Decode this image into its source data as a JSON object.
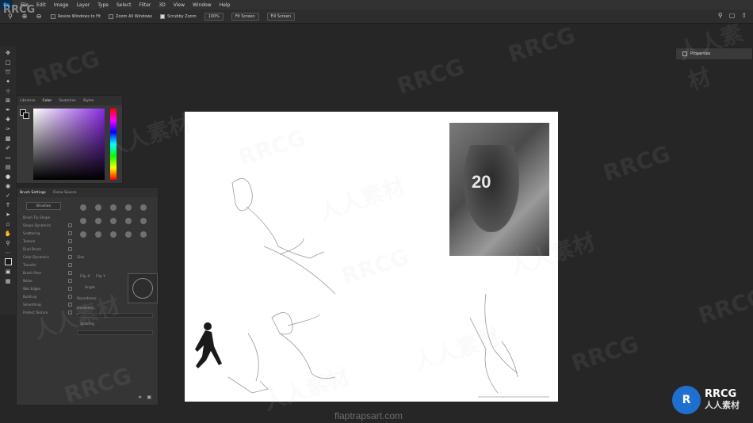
{
  "menu": {
    "logo": "Ps",
    "items": [
      "File",
      "Edit",
      "Image",
      "Layer",
      "Type",
      "Select",
      "Filter",
      "3D",
      "View",
      "Window",
      "Help"
    ]
  },
  "options": {
    "resize_windows": "Resize Windows to Fit",
    "zoom_all": "Zoom All Windows",
    "scrubby_zoom": "Scrubby Zoom",
    "zoom_100": "100%",
    "fit_screen": "Fit Screen",
    "fill_screen": "Fill Screen"
  },
  "color_panel": {
    "tabs": [
      "Libraries",
      "Color",
      "Swatches",
      "Styles"
    ],
    "active_tab": "Color",
    "color": "#8a2be2"
  },
  "brush_panel": {
    "tabs": [
      "Brush Settings",
      "Clone Source"
    ],
    "brushes_button": "Brushes",
    "settings": [
      "Brush Tip Shape",
      "Shape Dynamics",
      "Scattering",
      "Texture",
      "Dual Brush",
      "Color Dynamics",
      "Transfer",
      "Brush Pose",
      "Noise",
      "Wet Edges",
      "Build-up",
      "Smoothing",
      "Protect Texture"
    ],
    "size_label": "Size",
    "flip_x": "Flip X",
    "flip_y": "Flip Y",
    "angle_label": "Angle",
    "roundness_label": "Roundness",
    "hardness_label": "Hardness",
    "spacing_label": "Spacing"
  },
  "properties": {
    "title": "Properties"
  },
  "canvas": {
    "photo_number": "20"
  },
  "watermark": {
    "rrcg": "RRCG",
    "chinese": "人人素材",
    "top_left": "RRCG"
  },
  "credit": "flaptrapsart.com",
  "logo": {
    "mark": "R",
    "title": "RRCG",
    "subtitle": "人人素材"
  }
}
